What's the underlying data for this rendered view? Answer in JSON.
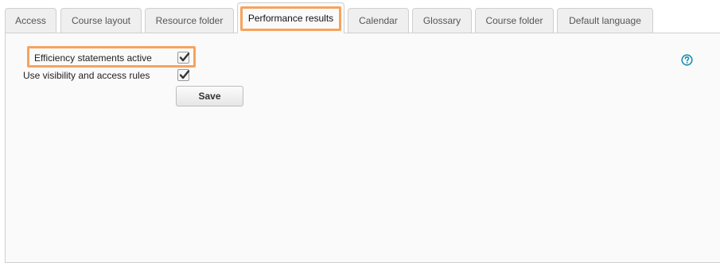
{
  "tabs": [
    {
      "label": "Access"
    },
    {
      "label": "Course layout"
    },
    {
      "label": "Resource folder"
    },
    {
      "label": "Performance results",
      "active": true
    },
    {
      "label": "Calendar"
    },
    {
      "label": "Glossary"
    },
    {
      "label": "Course folder"
    },
    {
      "label": "Default language"
    }
  ],
  "form": {
    "efficiency_label": "Efficiency statements active",
    "efficiency_checked": true,
    "visibility_label": "Use visibility and access rules",
    "visibility_checked": true,
    "save_label": "Save"
  },
  "colors": {
    "highlight": "#f7a35c",
    "help_icon": "#1a8fb0"
  },
  "icons": {
    "help": "help-circle-icon",
    "check": "checkmark-icon"
  }
}
